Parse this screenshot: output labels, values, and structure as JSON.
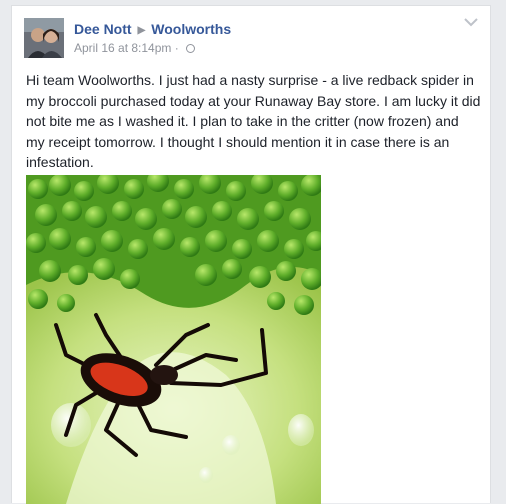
{
  "post": {
    "author": "Dee Nott",
    "target_page": "Woolworths",
    "timestamp": "April 16 at 8:14pm",
    "separator": "·",
    "privacy_icon": "globe-icon",
    "menu_icon": "chevron-down-icon",
    "text": "Hi team Woolworths. I just had a nasty surprise - a live redback spider in my broccoli purchased today at your Runaway Bay store. I am lucky it did not bite me as I washed it. I plan to take in the critter (now frozen) and my receipt tomorrow. I thought I should mention it in case there is an infestation."
  },
  "colors": {
    "link_blue": "#365899",
    "meta_gray": "#90949c",
    "body_text": "#1d2129",
    "page_bg": "#e9ebee"
  }
}
